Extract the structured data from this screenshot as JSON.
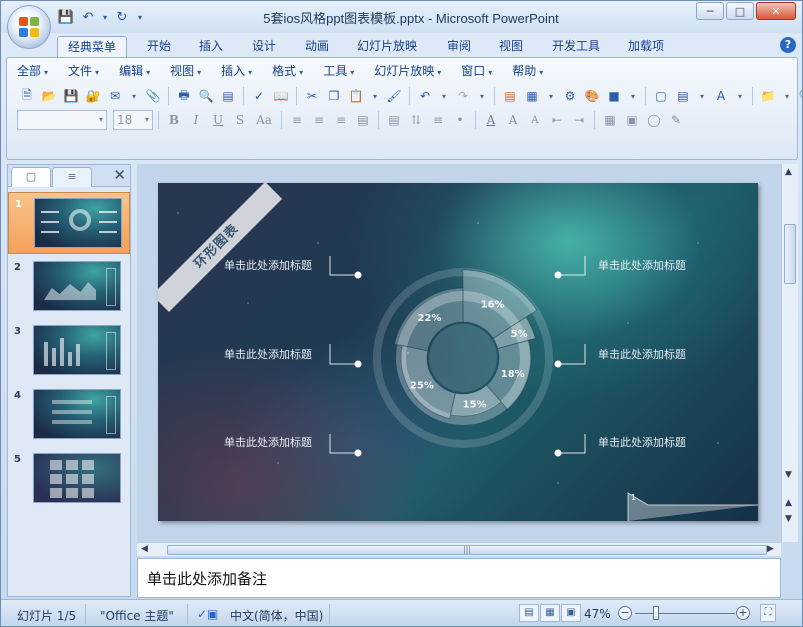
{
  "window": {
    "title": "5套ios风格ppt图表模板.pptx - Microsoft PowerPoint"
  },
  "tabs": [
    "经典菜单",
    "开始",
    "插入",
    "设计",
    "动画",
    "幻灯片放映",
    "审阅",
    "视图",
    "开发工具",
    "加载项"
  ],
  "menu": [
    "全部",
    "文件",
    "编辑",
    "视图",
    "插入",
    "格式",
    "工具",
    "幻灯片放映",
    "窗口",
    "帮助"
  ],
  "font_size": "18",
  "slide": {
    "banner": "环形图表",
    "labels_left": [
      "单击此处添加标题",
      "单击此处添加标题",
      "单击此处添加标题"
    ],
    "labels_right": [
      "单击此处添加标题",
      "单击此处添加标题",
      "单击此处添加标题"
    ],
    "page_number": "1"
  },
  "chart_data": {
    "type": "pie",
    "categories": [
      "",
      "",
      "",
      "",
      "",
      ""
    ],
    "values": [
      16,
      5,
      18,
      15,
      25,
      22
    ],
    "labels": [
      "16%",
      "5%",
      "18%",
      "15%",
      "25%",
      "22%"
    ]
  },
  "thumbnails": [
    "1",
    "2",
    "3",
    "4",
    "5"
  ],
  "notes": "单击此处添加备注",
  "status": {
    "slide_info": "幻灯片 1/5",
    "theme": "\"Office 主题\"",
    "language": "中文(简体，中国)",
    "zoom": "47%"
  },
  "colors": {
    "accent": "#f3a25a",
    "ribbon": "#dde8f5"
  }
}
